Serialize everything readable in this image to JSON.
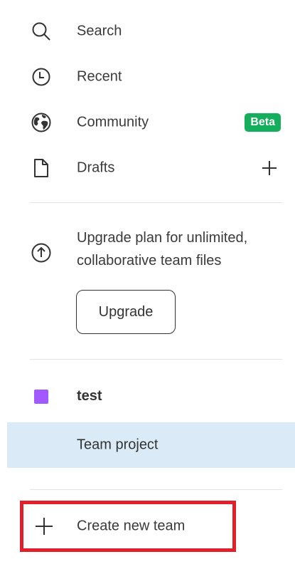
{
  "nav": {
    "search": {
      "label": "Search",
      "icon": "search-icon"
    },
    "recent": {
      "label": "Recent",
      "icon": "clock-icon"
    },
    "community": {
      "label": "Community",
      "icon": "globe-icon",
      "badge": "Beta"
    },
    "drafts": {
      "label": "Drafts",
      "icon": "file-icon",
      "action_icon": "plus-icon"
    }
  },
  "upgrade": {
    "icon": "arrow-up-circle-icon",
    "message": "Upgrade plan for unlimited, collaborative team files",
    "button_label": "Upgrade"
  },
  "team": {
    "name": "test",
    "color": "#a259ff",
    "project": "Team project"
  },
  "create_team": {
    "label": "Create new team",
    "icon": "plus-icon"
  },
  "colors": {
    "badge": "#14ae5c",
    "selected_row": "#daeaf7",
    "highlight_border": "#e0202a"
  }
}
